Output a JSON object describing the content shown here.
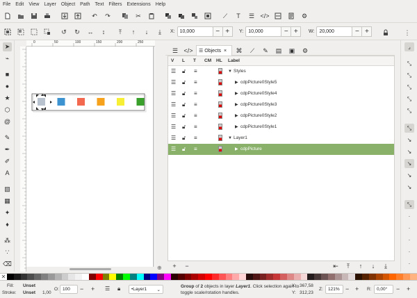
{
  "menu": [
    "File",
    "Edit",
    "View",
    "Layer",
    "Object",
    "Path",
    "Text",
    "Filters",
    "Extensions",
    "Help"
  ],
  "transform": {
    "x_label": "X:",
    "x_value": "10,000",
    "y_label": "Y:",
    "y_value": "10,000",
    "w_label": "W:",
    "w_value": "20,000",
    "minus": "−",
    "plus": "+"
  },
  "ruler_labels": [
    "0",
    "50",
    "100",
    "150",
    "200",
    "250"
  ],
  "panel": {
    "tab_label": "Objects",
    "headers": {
      "v": "V",
      "l": "L",
      "t": "T",
      "cm": "CM",
      "hl": "HL",
      "label": "Label"
    },
    "rows": [
      {
        "label": "Styles",
        "indent": 0,
        "expanded": true,
        "selected": false
      },
      {
        "label": "cdpPicture0Style5",
        "indent": 1,
        "expanded": false,
        "selected": false
      },
      {
        "label": "cdpPicture0Style4",
        "indent": 1,
        "expanded": false,
        "selected": false
      },
      {
        "label": "cdpPicture0Style3",
        "indent": 1,
        "expanded": false,
        "selected": false
      },
      {
        "label": "cdpPicture0Style2",
        "indent": 1,
        "expanded": false,
        "selected": false
      },
      {
        "label": "cdpPicture0Style1",
        "indent": 1,
        "expanded": false,
        "selected": false
      },
      {
        "label": "Layer1",
        "indent": 0,
        "expanded": true,
        "selected": false
      },
      {
        "label": "cdpPicture",
        "indent": 1,
        "expanded": false,
        "selected": true
      }
    ]
  },
  "canvas_squares": [
    "#b8c2cf",
    "#3d93d0",
    "#f26950",
    "#f6a21c",
    "#f7ef35",
    "#3aa02c"
  ],
  "palette": {
    "colors": [
      "#000000",
      "#1a1a1a",
      "#333333",
      "#4d4d4d",
      "#666666",
      "#808080",
      "#999999",
      "#b3b3b3",
      "#cccccc",
      "#e6e6e6",
      "#f2f2f2",
      "#ffffff",
      "#800000",
      "#ff0000",
      "#808000",
      "#ffff00",
      "#008000",
      "#00ff00",
      "#008080",
      "#00ffff",
      "#000080",
      "#0000ff",
      "#800080",
      "#ff00ff",
      "#2b0000",
      "#550000",
      "#800000",
      "#aa0000",
      "#d40000",
      "#ff0000",
      "#ff2a2a",
      "#ff5555",
      "#ff8080",
      "#ffaaaa",
      "#ffd5d5",
      "#280b0b",
      "#501616",
      "#782121",
      "#a02c2c",
      "#c83737",
      "#d35f5f",
      "#de8787",
      "#e9afaf",
      "#f4d7d7",
      "#241c1c",
      "#483737",
      "#6c5353",
      "#916f6f",
      "#ac9393",
      "#c8b7b7",
      "#e3dbdb",
      "#2b1100",
      "#552200",
      "#803300",
      "#aa4400",
      "#d45500",
      "#ff6600",
      "#ff7f2a",
      "#ff9955",
      "#ffb380"
    ]
  },
  "status": {
    "fill_label": "Fill:",
    "fill_value": "Unset",
    "stroke_label": "Stroke:",
    "stroke_value": "Unset",
    "stroke_width": "1,00",
    "opacity_label": "O:",
    "opacity_value": "100",
    "layer_value": "•Layer1",
    "message_bold1": "Group",
    "message_part1": " of ",
    "message_bold2": "2",
    "message_part2": " objects in layer ",
    "message_bold3": "Layer1",
    "message_part3": ". Click selection again to",
    "message_line2": "toggle scale/rotation handles.",
    "x_label": "X:",
    "x_value": "367,58",
    "y_label": "Y:",
    "y_value": "312,23",
    "zoom_label": "Z:",
    "zoom_value": "121%",
    "rot_label": "R:",
    "rot_value": "0,00°"
  }
}
